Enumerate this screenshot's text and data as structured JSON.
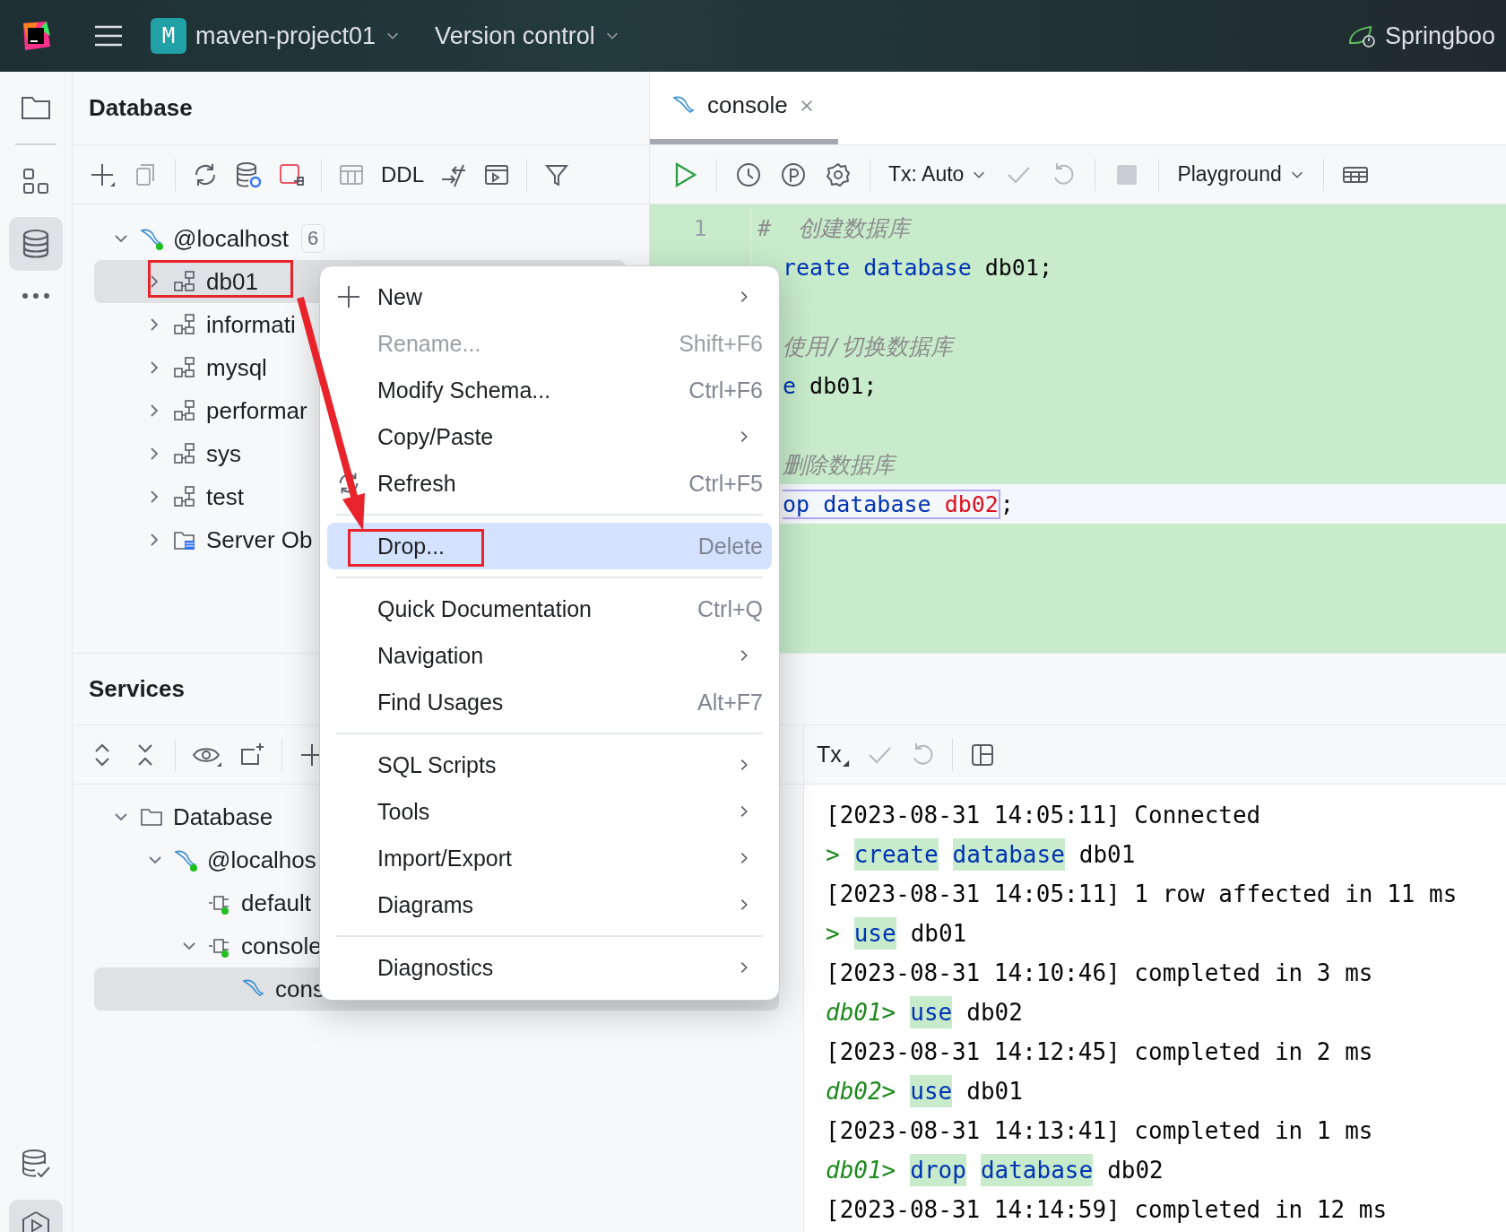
{
  "window": {
    "project_badge": "M",
    "project": "maven-project01",
    "vcs": "Version control",
    "run_config": "Springboo"
  },
  "database_panel": {
    "title": "Database",
    "toolbar_text": "DDL",
    "tree": [
      {
        "label": "@localhost",
        "kind": "server",
        "badge": "6",
        "expanded": true,
        "selected": false,
        "children": [
          {
            "label": "db01",
            "kind": "schema",
            "expanded": false,
            "selected": true
          },
          {
            "label": "informati",
            "kind": "schema",
            "expanded": false,
            "selected": false
          },
          {
            "label": "mysql",
            "kind": "schema",
            "expanded": false,
            "selected": false
          },
          {
            "label": "performar",
            "kind": "schema",
            "expanded": false,
            "selected": false
          },
          {
            "label": "sys",
            "kind": "schema",
            "expanded": false,
            "selected": false
          },
          {
            "label": "test",
            "kind": "schema",
            "expanded": false,
            "selected": false
          },
          {
            "label": "Server Ob",
            "kind": "server-objects",
            "expanded": false,
            "selected": false
          }
        ]
      }
    ]
  },
  "editor": {
    "tab": {
      "label": "console",
      "selected": true
    },
    "tx": "Tx: Auto",
    "mode": "Playground",
    "lines": [
      {
        "kind": "code",
        "number": "1",
        "clipped": false,
        "current": false,
        "segments": [
          {
            "text": "#  创建数据库",
            "kind": "comment"
          }
        ]
      },
      {
        "kind": "code",
        "clipped": true,
        "current": false,
        "segments": [
          {
            "text": "reate database",
            "kind": "keyword"
          },
          {
            "text": " db01;",
            "kind": "plain"
          }
        ]
      },
      {
        "kind": "blank"
      },
      {
        "kind": "code",
        "clipped": true,
        "current": false,
        "segments": [
          {
            "text": "使用/切换数据库",
            "kind": "comment"
          }
        ]
      },
      {
        "kind": "code",
        "clipped": true,
        "current": false,
        "segments": [
          {
            "text": "e",
            "kind": "keyword"
          },
          {
            "text": " db01;",
            "kind": "plain"
          }
        ]
      },
      {
        "kind": "blank"
      },
      {
        "kind": "code",
        "clipped": true,
        "current": false,
        "segments": [
          {
            "text": "删除数据库",
            "kind": "comment"
          }
        ]
      },
      {
        "kind": "code",
        "clipped": true,
        "current": true,
        "segments": [
          {
            "text": "op database ",
            "kind": "keyword",
            "framed": true
          },
          {
            "text": "db02",
            "kind": "error",
            "framed": true
          },
          {
            "text": ";",
            "kind": "plain"
          }
        ]
      }
    ]
  },
  "services": {
    "title": "Services",
    "tree": [
      {
        "label": "Database",
        "kind": "folder",
        "expanded": true,
        "selected": false,
        "children": [
          {
            "label": "@localhos",
            "kind": "server",
            "expanded": true,
            "selected": false,
            "children": [
              {
                "label": "default",
                "kind": "session",
                "selected": false
              },
              {
                "label": "console",
                "kind": "session",
                "expanded": true,
                "selected": false,
                "children": [
                  {
                    "label": "cons",
                    "kind": "console",
                    "selected": true
                  }
                ]
              }
            ]
          }
        ]
      }
    ]
  },
  "console": {
    "toolbar_text": "Tx",
    "lines": [
      [
        {
          "text": "[2023-08-31 14:05:11] Connected",
          "kind": "plain"
        }
      ],
      [
        {
          "text": ">",
          "kind": "prompt"
        },
        {
          "text": "create",
          "kind": "keyword"
        },
        {
          "text": "database",
          "kind": "keyword"
        },
        {
          "text": "db01",
          "kind": "plain"
        }
      ],
      [
        {
          "text": "[2023-08-31 14:05:11] 1 row affected in 11 ms",
          "kind": "plain"
        }
      ],
      [
        {
          "text": ">",
          "kind": "prompt"
        },
        {
          "text": "use",
          "kind": "keyword"
        },
        {
          "text": "db01",
          "kind": "plain"
        }
      ],
      [
        {
          "text": "[2023-08-31 14:10:46] completed in 3 ms",
          "kind": "plain"
        }
      ],
      [
        {
          "text": "db01>",
          "kind": "prompt"
        },
        {
          "text": "use",
          "kind": "keyword"
        },
        {
          "text": "db02",
          "kind": "plain"
        }
      ],
      [
        {
          "text": "[2023-08-31 14:12:45] completed in 2 ms",
          "kind": "plain"
        }
      ],
      [
        {
          "text": "db02>",
          "kind": "prompt"
        },
        {
          "text": "use",
          "kind": "keyword"
        },
        {
          "text": "db01",
          "kind": "plain"
        }
      ],
      [
        {
          "text": "[2023-08-31 14:13:41] completed in 1 ms",
          "kind": "plain"
        }
      ],
      [
        {
          "text": "db01>",
          "kind": "prompt"
        },
        {
          "text": "drop",
          "kind": "keyword"
        },
        {
          "text": "database",
          "kind": "keyword"
        },
        {
          "text": "db02",
          "kind": "plain"
        }
      ],
      [
        {
          "text": "[2023-08-31 14:14:59] completed in 12 ms",
          "kind": "plain"
        }
      ]
    ]
  },
  "context_menu": {
    "items": [
      {
        "kind": "item",
        "label": "New",
        "submenu": true,
        "disabled": false,
        "selected": false
      },
      {
        "kind": "item",
        "label": "Rename...",
        "shortcut": "Shift+F6",
        "submenu": false,
        "disabled": true,
        "selected": false
      },
      {
        "kind": "item",
        "label": "Modify Schema...",
        "shortcut": "Ctrl+F6",
        "submenu": false,
        "disabled": false,
        "selected": false
      },
      {
        "kind": "item",
        "label": "Copy/Paste",
        "submenu": true,
        "disabled": false,
        "selected": false
      },
      {
        "kind": "item",
        "label": "Refresh",
        "shortcut": "Ctrl+F5",
        "submenu": false,
        "disabled": false,
        "selected": false
      },
      {
        "kind": "separator"
      },
      {
        "kind": "item",
        "label": "Drop...",
        "shortcut": "Delete",
        "submenu": false,
        "disabled": false,
        "selected": true
      },
      {
        "kind": "separator"
      },
      {
        "kind": "item",
        "label": "Quick Documentation",
        "shortcut": "Ctrl+Q",
        "submenu": false,
        "disabled": false,
        "selected": false
      },
      {
        "kind": "item",
        "label": "Navigation",
        "submenu": true,
        "disabled": false,
        "selected": false
      },
      {
        "kind": "item",
        "label": "Find Usages",
        "shortcut": "Alt+F7",
        "submenu": false,
        "disabled": false,
        "selected": false
      },
      {
        "kind": "separator"
      },
      {
        "kind": "item",
        "label": "SQL Scripts",
        "submenu": true,
        "disabled": false,
        "selected": false
      },
      {
        "kind": "item",
        "label": "Tools",
        "submenu": true,
        "disabled": false,
        "selected": false
      },
      {
        "kind": "item",
        "label": "Import/Export",
        "submenu": true,
        "disabled": false,
        "selected": false
      },
      {
        "kind": "item",
        "label": "Diagrams",
        "submenu": true,
        "disabled": false,
        "selected": false
      },
      {
        "kind": "separator"
      },
      {
        "kind": "item",
        "label": "Diagnostics",
        "submenu": true,
        "disabled": false,
        "selected": false
      }
    ]
  }
}
